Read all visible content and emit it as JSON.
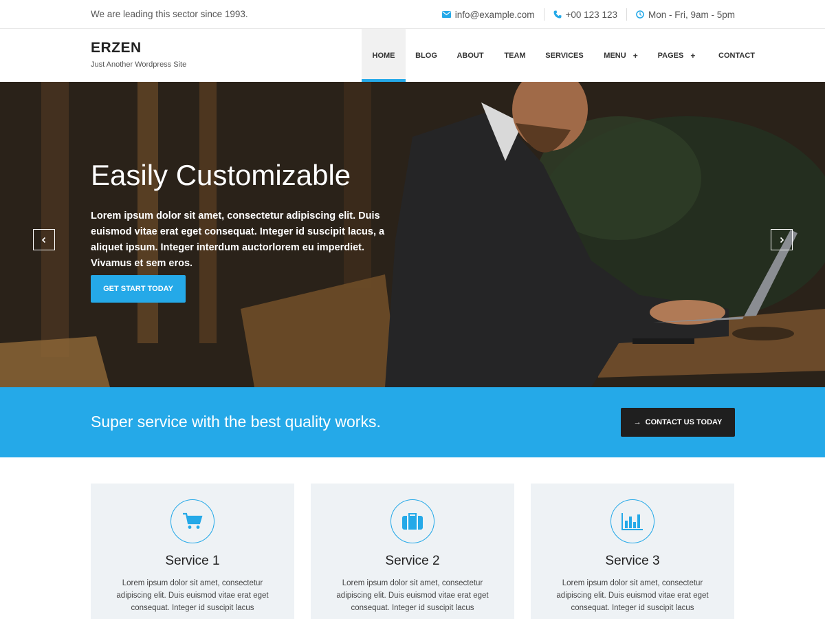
{
  "topbar": {
    "tagline": "We are leading this sector since 1993.",
    "email": "info@example.com",
    "phone": "+00 123 123",
    "hours": "Mon - Fri, 9am - 5pm",
    "icons": [
      "envelope-icon",
      "phone-icon",
      "clock-icon"
    ],
    "icon_color": "#25a9e8"
  },
  "header": {
    "logo": "ERZEN",
    "subtitle": "Just Another Wordpress Site"
  },
  "nav": {
    "items": [
      {
        "label": "HOME",
        "active": true
      },
      {
        "label": "BLOG"
      },
      {
        "label": "ABOUT"
      },
      {
        "label": "TEAM"
      },
      {
        "label": "SERVICES"
      },
      {
        "label": "MENU",
        "has_submenu": true
      },
      {
        "label": "PAGES",
        "has_submenu": true
      },
      {
        "label": "CONTACT"
      }
    ],
    "submenu_symbol": "+"
  },
  "hero": {
    "title": "Easily Customizable",
    "text": "Lorem ipsum dolor sit amet, consectetur adipiscing elit. Duis euismod vitae erat eget consequat. Integer id suscipit lacus, a aliquet ipsum. Integer interdum auctorlorem eu imperdiet. Vivamus et sem eros.",
    "button_label": "GET START TODAY",
    "prev_arrow": "‹",
    "next_arrow": "›"
  },
  "cta": {
    "text": "Super service with the best quality works.",
    "button_label": "CONTACT US TODAY",
    "button_arrow": "→"
  },
  "services": [
    {
      "title": "Service 1",
      "icon": "cart-icon",
      "desc": "Lorem ipsum dolor sit amet, consectetur adipiscing elit. Duis euismod vitae erat eget consequat. Integer id suscipit lacus"
    },
    {
      "title": "Service 2",
      "icon": "briefcase-icon",
      "desc": "Lorem ipsum dolor sit amet, consectetur adipiscing elit. Duis euismod vitae erat eget consequat. Integer id suscipit lacus"
    },
    {
      "title": "Service 3",
      "icon": "bar-chart-icon",
      "desc": "Lorem ipsum dolor sit amet, consectetur adipiscing elit. Duis euismod vitae erat eget consequat. Integer id suscipit lacus"
    }
  ],
  "colors": {
    "accent": "#25a9e8",
    "dark_button": "#1f1f1f",
    "card_bg": "#eef2f5"
  }
}
